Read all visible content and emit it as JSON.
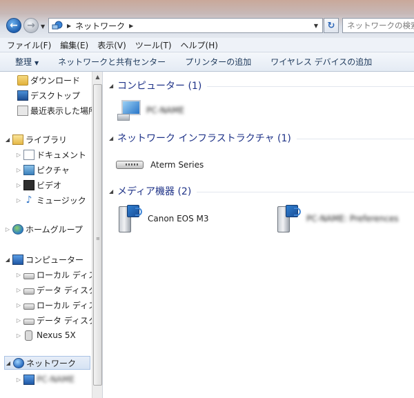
{
  "address": {
    "breadcrumb": "ネットワーク",
    "search_placeholder": "ネットワークの検索"
  },
  "menu": {
    "items": [
      "ファイル(F)",
      "編集(E)",
      "表示(V)",
      "ツール(T)",
      "ヘルプ(H)"
    ]
  },
  "command_bar": {
    "organize": "整理",
    "network_center": "ネットワークと共有センター",
    "add_printer": "プリンターの追加",
    "add_wireless": "ワイヤレス デバイスの追加"
  },
  "nav": {
    "downloads": "ダウンロード",
    "desktop": "デスクトップ",
    "recent": "最近表示した場所",
    "libraries": "ライブラリ",
    "documents": "ドキュメント",
    "pictures": "ピクチャ",
    "videos": "ビデオ",
    "music": "ミュージック",
    "homegroup": "ホームグループ",
    "computer": "コンピューター",
    "local_disk_1": "ローカル ディスク",
    "data_disk_1": "データ ディスク",
    "local_disk_2": "ローカル ディスク",
    "data_disk_2": "データ ディスク",
    "nexus": "Nexus 5X",
    "network": "ネットワーク",
    "network_child": "PC-NAME"
  },
  "groups": {
    "computer": {
      "title": "コンピューター (1)",
      "items": [
        {
          "label": "PC-NAME"
        }
      ]
    },
    "infrastructure": {
      "title": "ネットワーク インフラストラクチャ (1)",
      "items": [
        {
          "label": "Aterm Series"
        }
      ]
    },
    "media": {
      "title": "メディア機器 (2)",
      "items": [
        {
          "label": "Canon EOS M3"
        },
        {
          "label": "PC-NAME: Preferences"
        }
      ]
    }
  },
  "colors": {
    "group_title": "#1e3287",
    "command_text": "#1e395b",
    "selection": "#d6e3f3"
  }
}
